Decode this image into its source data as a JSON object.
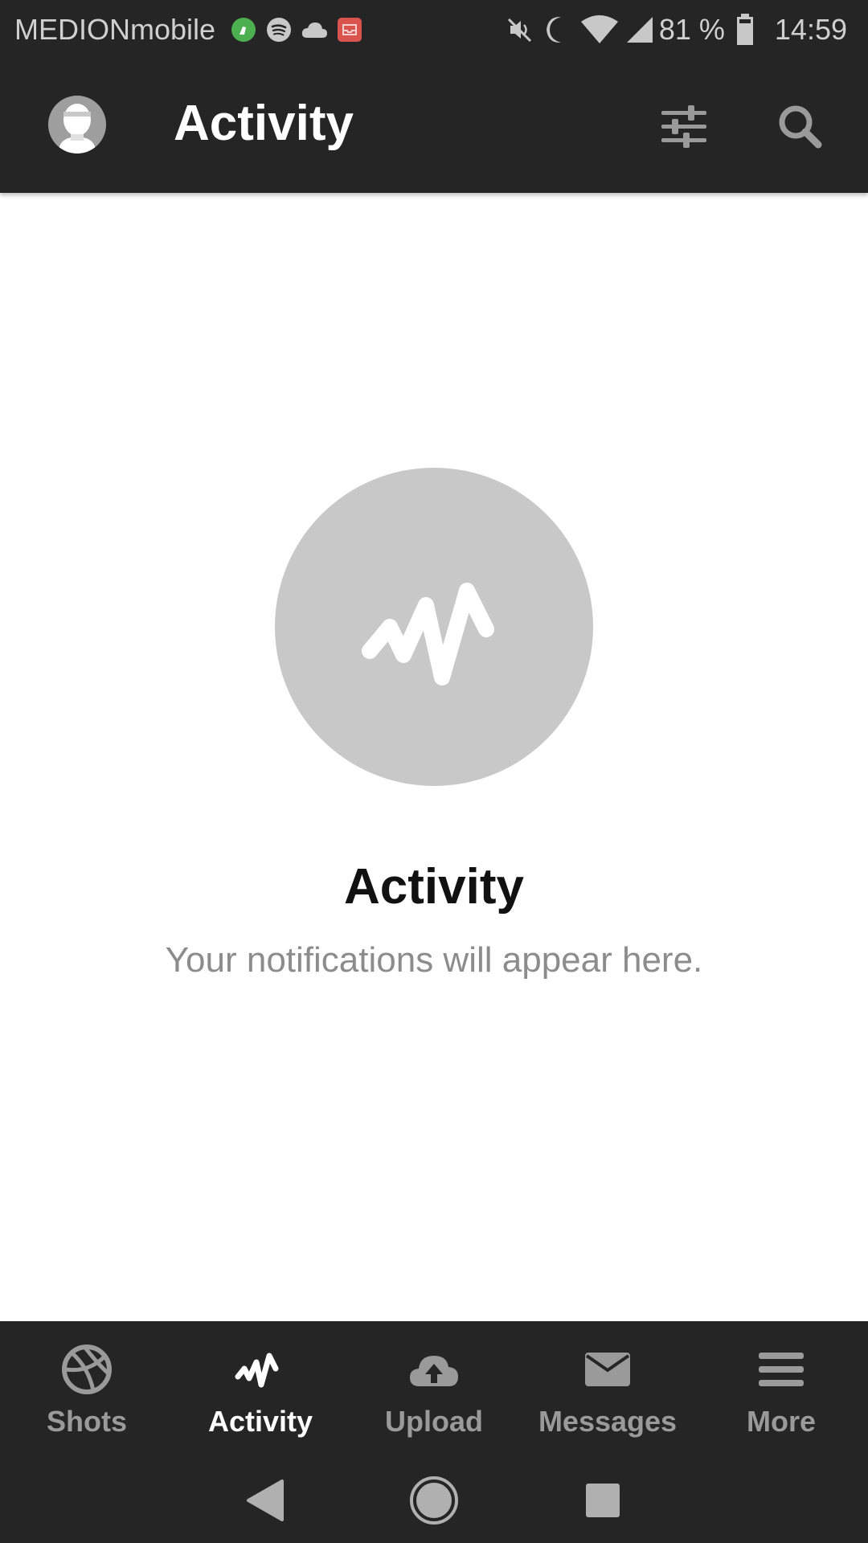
{
  "status_bar": {
    "carrier": "MEDIONmobile",
    "notification_icons": [
      "cleaner-icon",
      "spotify-icon",
      "cloud-icon",
      "inbox-icon"
    ],
    "status_icons": [
      "mute-icon",
      "do-not-disturb-moon-icon",
      "wifi-icon",
      "cell-signal-icon",
      "battery-icon"
    ],
    "battery": "81 %",
    "time": "14:59"
  },
  "app_bar": {
    "title": "Activity",
    "actions": [
      "filter-sliders-icon",
      "search-icon"
    ]
  },
  "empty_state": {
    "icon": "activity-pulse-icon",
    "title": "Activity",
    "subtitle": "Your notifications will appear here."
  },
  "bottom_nav": {
    "items": [
      {
        "label": "Shots",
        "icon": "dribbble-ball-icon",
        "active": false
      },
      {
        "label": "Activity",
        "icon": "activity-pulse-icon",
        "active": true
      },
      {
        "label": "Upload",
        "icon": "cloud-upload-icon",
        "active": false
      },
      {
        "label": "Messages",
        "icon": "envelope-icon",
        "active": false
      },
      {
        "label": "More",
        "icon": "hamburger-menu-icon",
        "active": false
      }
    ]
  },
  "system_nav": [
    "back-icon",
    "home-icon",
    "recents-icon"
  ],
  "colors": {
    "bar_background": "#252525",
    "page_background": "#ffffff",
    "empty_circle": "#c8c8c8",
    "inactive_icon": "#9a9a9a",
    "active_icon": "#ffffff",
    "subtitle_text": "#8c8c8c"
  }
}
